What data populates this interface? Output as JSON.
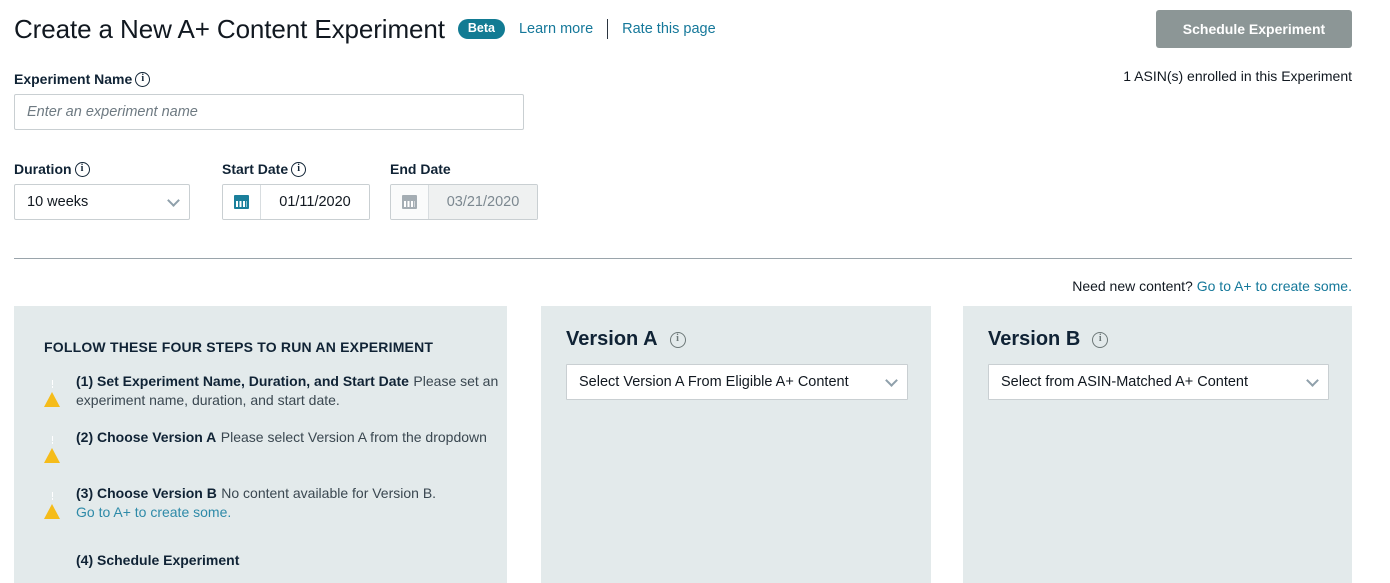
{
  "header": {
    "title": "Create a New A+ Content Experiment",
    "badge": "Beta",
    "learn_more": "Learn more",
    "rate_page": "Rate this page",
    "schedule_button": "Schedule Experiment",
    "asin_note": "1 ASIN(s) enrolled in this Experiment"
  },
  "form": {
    "name_label": "Experiment Name",
    "name_value": "",
    "name_placeholder": "Enter an experiment name",
    "duration_label": "Duration",
    "duration_value": "10 weeks",
    "start_label": "Start Date",
    "start_value": "01/11/2020",
    "end_label": "End Date",
    "end_value": "03/21/2020"
  },
  "content_note": {
    "text": "Need new content? ",
    "link": "Go to A+ to create some."
  },
  "steps_panel": {
    "title": "FOLLOW THESE FOUR STEPS TO RUN AN EXPERIMENT",
    "steps": [
      {
        "heading": "(1) Set Experiment Name, Duration, and Start Date",
        "description": "Please set an experiment name, duration, and start date.",
        "link": "",
        "warning": true
      },
      {
        "heading": "(2) Choose Version A",
        "description": "Please select Version A from the dropdown",
        "link": "",
        "warning": true
      },
      {
        "heading": "(3) Choose Version B",
        "description": "No content available for Version B.",
        "link": "Go to A+ to create some.",
        "warning": true
      },
      {
        "heading": "(4) Schedule Experiment",
        "description": "",
        "link": "",
        "warning": false
      }
    ]
  },
  "version_a": {
    "title": "Version A",
    "select_value": "Select Version A From Eligible A+ Content"
  },
  "version_b": {
    "title": "Version B",
    "select_value": "Select from ASIN-Matched A+ Content"
  },
  "colors": {
    "accent_teal": "#15789a",
    "badge_teal": "#127b93",
    "panel_bg": "#e3eaeb",
    "warning_amber": "#f5bc1a",
    "disabled_button": "#8c9696"
  }
}
